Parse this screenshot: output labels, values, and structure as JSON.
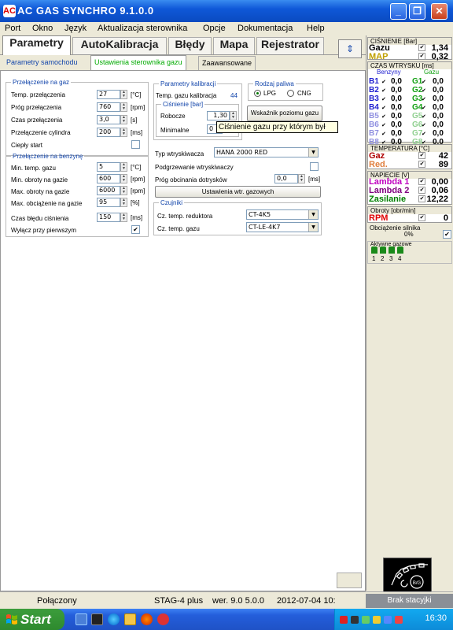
{
  "window": {
    "title": "AC GAS SYNCHRO  9.1.0.0",
    "icon_text": "AC",
    "minimize": "_",
    "maximize": "❐",
    "close": "✕"
  },
  "menu": [
    "Port",
    "Okno",
    "Język",
    "Aktualizacja sterownika",
    "Opcje",
    "Dokumentacja",
    "Help"
  ],
  "tabs": [
    "Parametry",
    "AutoKalibracja",
    "Błędy",
    "Mapa",
    "Rejestrator"
  ],
  "side_button": "⇕",
  "subtabs": [
    "Parametry samochodu",
    "Ustawienia sterownika gazu",
    "Zaawansowane"
  ],
  "gas_switch": {
    "legend": "Przełączenie na gaz",
    "rows": [
      {
        "label": "Temp. przełączenia",
        "value": "27",
        "unit": "[°C]"
      },
      {
        "label": "Próg przełączenia",
        "value": "760",
        "unit": "[rpm]"
      },
      {
        "label": "Czas przełączenia",
        "value": "3,0",
        "unit": "[s]"
      },
      {
        "label": "Przełączenie cylindra",
        "value": "200",
        "unit": "[ms]"
      }
    ],
    "warm_start": "Ciepły start"
  },
  "petrol_switch": {
    "legend": "Przełączenie na benzynę",
    "rows": [
      {
        "label": "Min. temp. gazu",
        "value": "5",
        "unit": "[°C]"
      },
      {
        "label": "Min. obroty na gazie",
        "value": "600",
        "unit": "[rpm]"
      },
      {
        "label": "Max. obroty na gazie",
        "value": "6000",
        "unit": "[rpm]"
      },
      {
        "label": "Max. obciążenie na gazie",
        "value": "95",
        "unit": "[%]"
      }
    ],
    "error_time_label": "Czas błędu ciśnienia",
    "error_time_value": "150",
    "error_time_unit": "[ms]",
    "first_off_label": "Wyłącz przy pierwszym",
    "first_off_check": "✔"
  },
  "calib": {
    "legend": "Parametry kalibracji",
    "temp_label": "Temp. gazu kalibracja",
    "temp_value": "44",
    "pressure_legend": "Ciśnienie [bar]",
    "working_label": "Robocze",
    "working_value": "1,30",
    "minimal_label": "Minimalne",
    "minimal_value": "0"
  },
  "fuel": {
    "legend": "Rodzaj paliwa",
    "lpg": "LPG",
    "cng": "CNG"
  },
  "gauge_btn": "Wskaźnik poziomu gazu",
  "tooltip": "Ciśnienie gazu przy którym był",
  "injectors": {
    "type_label": "Typ wtryskiwacza",
    "type_value": "HANA 2000 RED",
    "heat_label": "Podgrzewanie wtryskiwaczy",
    "cutoff_label": "Próg obcinania dotrysków",
    "cutoff_value": "0,0",
    "cutoff_unit": "[ms]",
    "settings_btn": "Ustawienia wtr. gazowych"
  },
  "sensors": {
    "legend": "Czujniki",
    "reducer_label": "Cz. temp. reduktora",
    "reducer_value": "CT-4K5",
    "gas_label": "Cz. temp. gazu",
    "gas_value": "CT-LE-4K7"
  },
  "right": {
    "pressure_head": "CIŚNIENIE [Bar]",
    "gaz_label": "Gazu",
    "gaz_value": "1,34",
    "map_label": "MAP",
    "map_value": "0,32",
    "inj_head": "CZAS WTRYSKU  [ms]",
    "col_b": "Benzyny",
    "col_g": "Gazu",
    "inj_rows": [
      {
        "b": "B1",
        "bv": "0,0",
        "g": "G1",
        "gv": "0,0"
      },
      {
        "b": "B2",
        "bv": "0,0",
        "g": "G2",
        "gv": "0,0"
      },
      {
        "b": "B3",
        "bv": "0,0",
        "g": "G3",
        "gv": "0,0"
      },
      {
        "b": "B4",
        "bv": "0,0",
        "g": "G4",
        "gv": "0,0"
      },
      {
        "b": "B5",
        "bv": "0,0",
        "g": "G5",
        "gv": "0,0"
      },
      {
        "b": "B6",
        "bv": "0,0",
        "g": "G6",
        "gv": "0,0"
      },
      {
        "b": "B7",
        "bv": "0,0",
        "g": "G7",
        "gv": "0,0"
      },
      {
        "b": "B8",
        "bv": "0,0",
        "g": "G8",
        "gv": "0,0"
      }
    ],
    "temp_head": "TEMPERATURA  [°C]",
    "gaz_t_label": "Gaz",
    "gaz_t_value": "42",
    "red_label": "Red.",
    "red_value": "89",
    "volt_head": "NAPIĘCIE [V]",
    "l1_label": "Lambda 1",
    "l1_value": "0,00",
    "l2_label": "Lambda 2",
    "l2_value": "0,06",
    "zas_label": "Zasilanie",
    "zas_value": "12,22",
    "rpm_head": "Obroty [obr/min]",
    "rpm_label": "RPM",
    "rpm_value": "0",
    "load_head": "Obciążenie silnika",
    "load_value": "0%",
    "active_head": "Aktywne gazowe",
    "active_nums": [
      "1",
      "2",
      "3",
      "4"
    ],
    "logo_text": "B/G",
    "colors": {
      "gaz": "#b00000",
      "map": "#c0a000",
      "benz": "#2020d0",
      "gazu": "#10a010",
      "lambda1": "#c000c0",
      "lambda2": "#800080",
      "zas": "#008000",
      "rpm": "#e00000"
    }
  },
  "status": {
    "connected": "Połączony",
    "device": "STAG-4 plus",
    "ver": "wer. 9.0  5.0.0",
    "date": "2012-07-04 10:",
    "right": "Brak stacyjki"
  },
  "taskbar": {
    "start": "Start",
    "clock": "16:30"
  }
}
